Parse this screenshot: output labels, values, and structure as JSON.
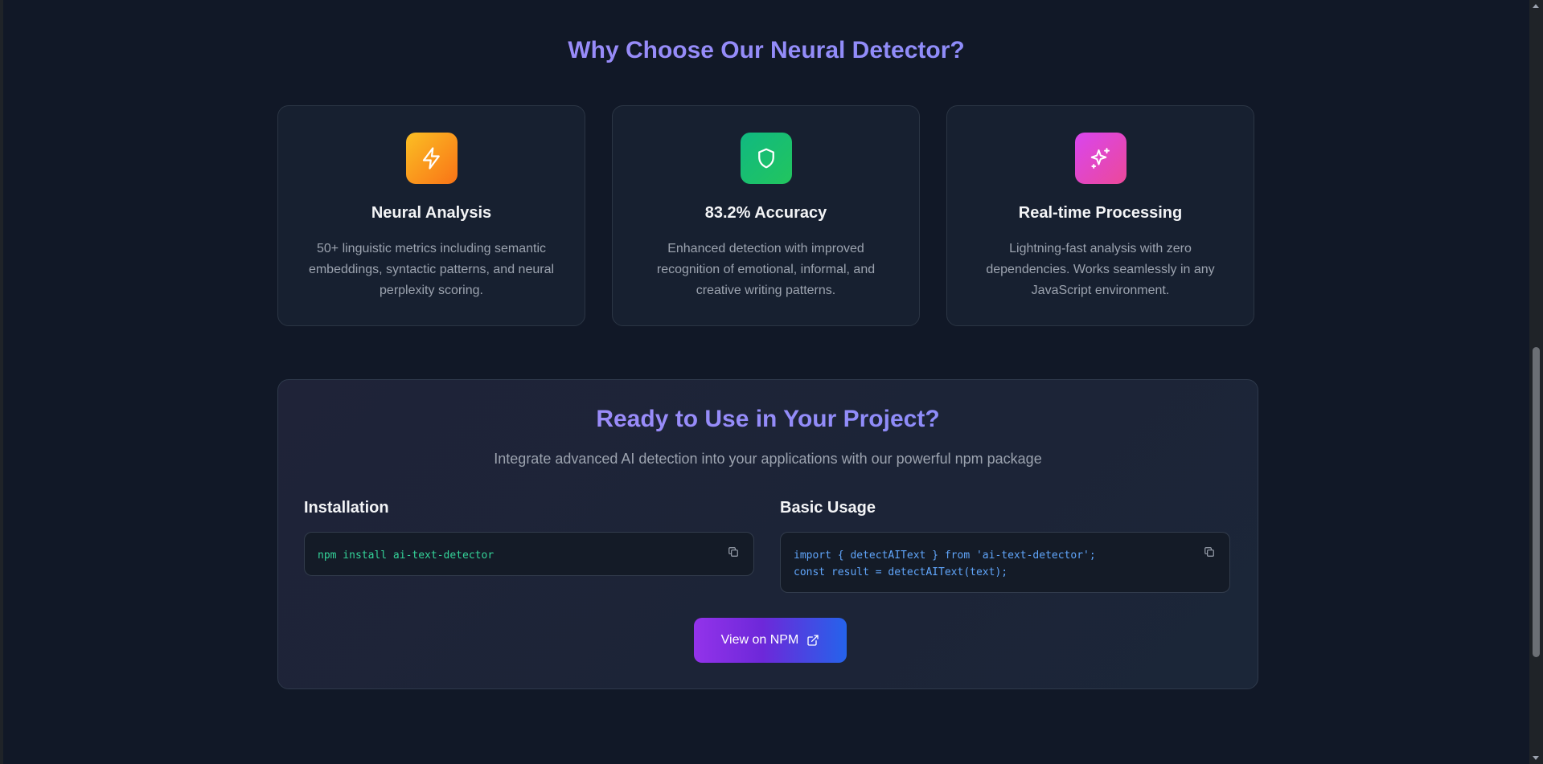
{
  "features_section": {
    "title": "Why Choose Our Neural Detector?",
    "cards": [
      {
        "icon": "lightning-icon",
        "color": "#f97316",
        "title": "Neural Analysis",
        "description": "50+ linguistic metrics including semantic embeddings, syntactic patterns, and neural perplexity scoring."
      },
      {
        "icon": "shield-icon",
        "color": "#10b981",
        "title": "83.2% Accuracy",
        "description": "Enhanced detection with improved recognition of emotional, informal, and creative writing patterns."
      },
      {
        "icon": "sparkles-icon",
        "color": "#ec4899",
        "title": "Real-time Processing",
        "description": "Lightning-fast analysis with zero dependencies. Works seamlessly in any JavaScript environment."
      }
    ]
  },
  "ready_section": {
    "title": "Ready to Use in Your Project?",
    "subtitle": "Integrate advanced AI detection into your applications with our powerful npm package",
    "installation": {
      "heading": "Installation",
      "code": "npm install ai-text-detector",
      "copy_icon": "copy-icon"
    },
    "usage": {
      "heading": "Basic Usage",
      "code": "import { detectAIText } from 'ai-text-detector';\nconst result = detectAIText(text);",
      "copy_icon": "copy-icon"
    },
    "button": {
      "label": "View on NPM",
      "icon": "external-link-icon"
    }
  },
  "colors": {
    "background": "#111827",
    "accent_purple": "#a78bfa",
    "accent_indigo": "#818cf8",
    "code_green": "#34d399",
    "code_blue": "#60a5fa"
  }
}
